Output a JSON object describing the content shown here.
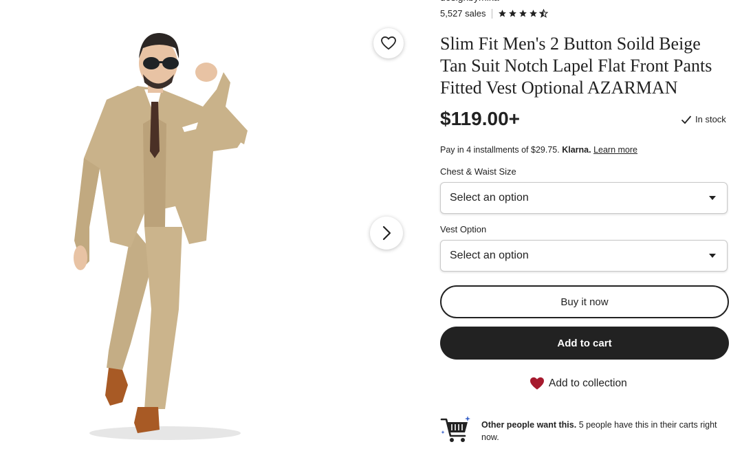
{
  "shop": {
    "name": "designbymika",
    "sales": "5,527 sales",
    "rating_stars": 4.5
  },
  "listing": {
    "title": "Slim Fit Men's 2 Button Soild Beige Tan Suit Notch Lapel Flat Front Pants Fitted Vest Optional AZARMAN",
    "price": "$119.00+",
    "stock": "In stock"
  },
  "installments": {
    "prefix": "Pay in 4 installments of $29.75.",
    "provider": "Klarna.",
    "link": "Learn more"
  },
  "options": [
    {
      "label": "Chest & Waist Size",
      "value": "Select an option"
    },
    {
      "label": "Vest Option",
      "value": "Select an option"
    }
  ],
  "actions": {
    "buy_now": "Buy it now",
    "add_to_cart": "Add to cart",
    "add_to_collection": "Add to collection"
  },
  "demand": {
    "bold": "Other people want this.",
    "text": "5 people have this in their carts right now."
  },
  "icons": {
    "favorite": "heart-outline-icon",
    "next": "chevron-right-icon",
    "stock": "check-icon",
    "collection": "heart-filled-icon",
    "cart": "shopping-cart-icon",
    "star": "star-icon"
  },
  "colors": {
    "accent": "#222222",
    "heart": "#a61a2e",
    "suit": "#c9b28a",
    "shoes": "#a85a25"
  }
}
